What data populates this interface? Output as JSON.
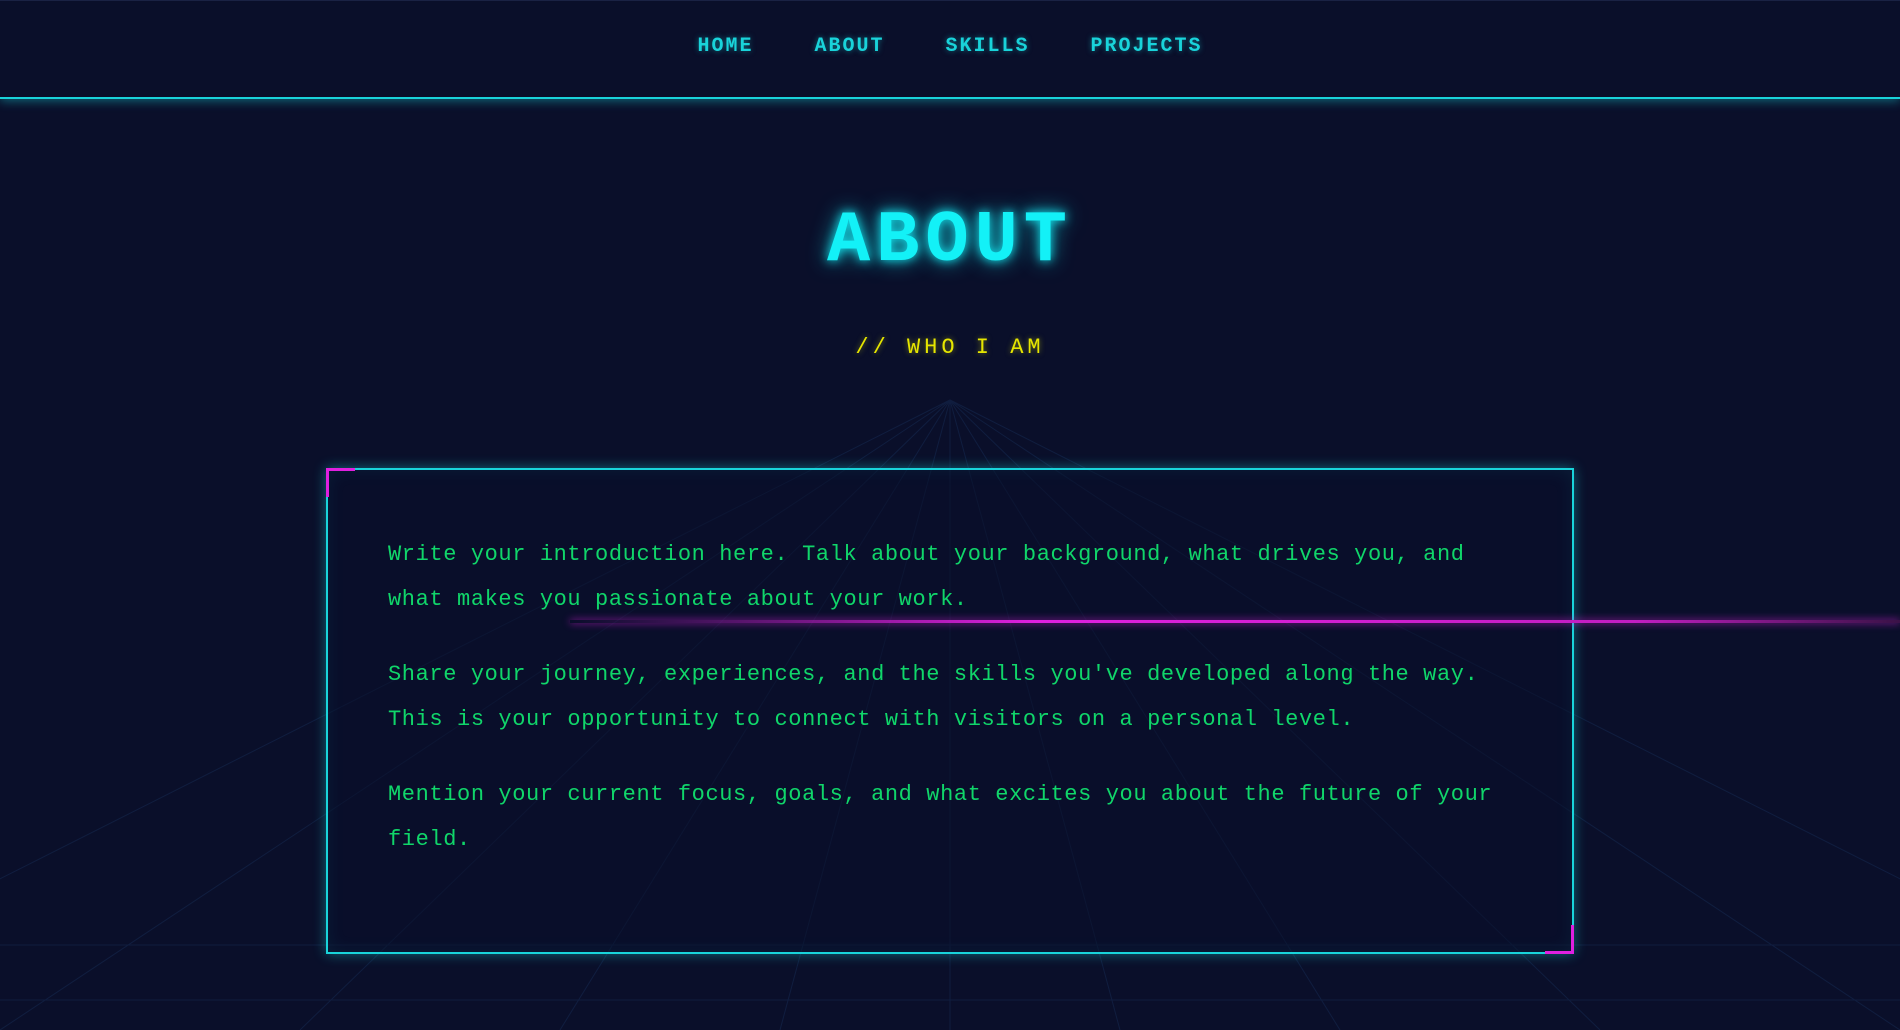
{
  "nav": {
    "items": [
      {
        "label": "HOME"
      },
      {
        "label": "ABOUT"
      },
      {
        "label": "SKILLS"
      },
      {
        "label": "PROJECTS"
      }
    ]
  },
  "hero": {
    "title": "ABOUT",
    "subtitle": "// WHO I AM"
  },
  "about": {
    "paragraphs": [
      "Write your introduction here. Talk about your background, what drives you, and what makes you passionate about your work.",
      "Share your journey, experiences, and the skills you've developed along the way. This is your opportunity to connect with visitors on a personal level.",
      "Mention your current focus, goals, and what excites you about the future of your field."
    ]
  },
  "colors": {
    "background": "#0a0f2a",
    "cyan": "#19d3da",
    "title_cyan": "#13f1f7",
    "yellow": "#e6e600",
    "green": "#10d66a",
    "magenta": "#e020e0"
  }
}
